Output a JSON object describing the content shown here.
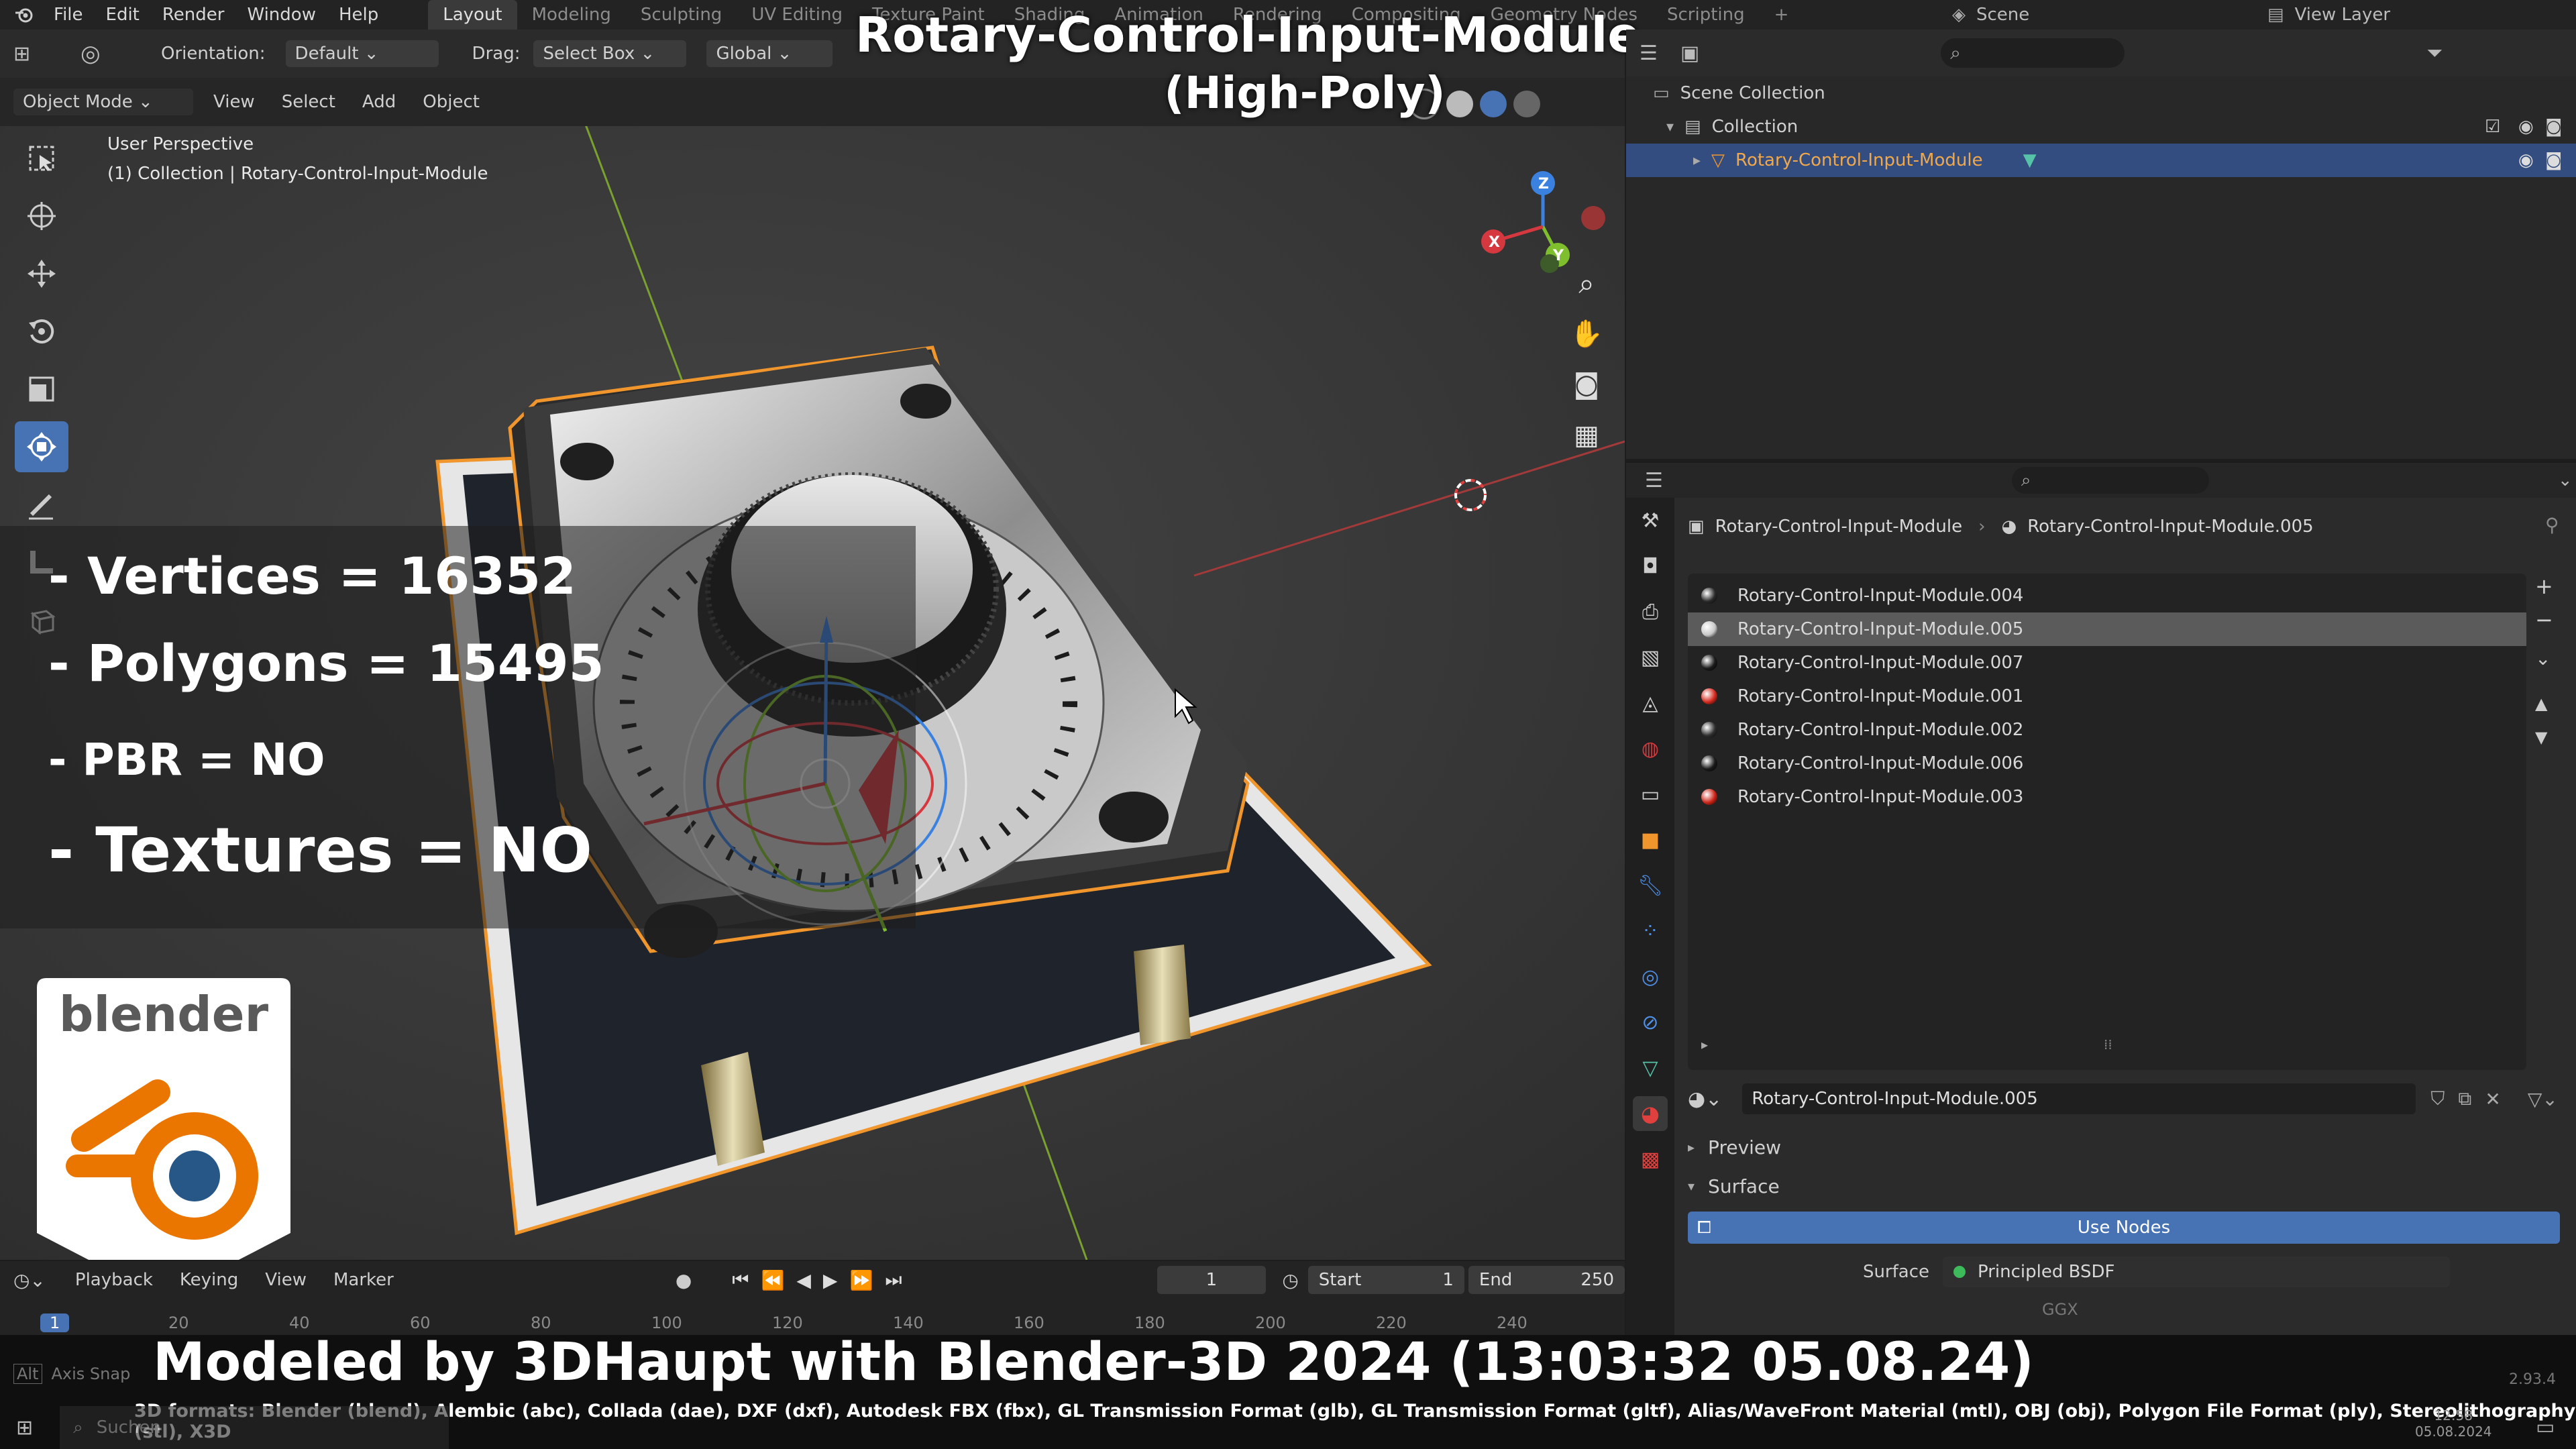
{
  "topbar": {
    "menus": [
      "File",
      "Edit",
      "Render",
      "Window",
      "Help"
    ],
    "workspaces": [
      "Layout",
      "Modeling",
      "Sculpting",
      "UV Editing",
      "Texture Paint",
      "Shading",
      "Animation",
      "Rendering",
      "Compositing",
      "Geometry Nodes",
      "Scripting"
    ],
    "active_workspace": "Layout",
    "add_tab": "+",
    "scene": "Scene",
    "view_layer": "View Layer"
  },
  "viewport_header": {
    "orientation_label": "Orientation:",
    "orientation_value": "Default",
    "drag_label": "Drag:",
    "drag_value": "Select Box",
    "transform": "Global",
    "mode": "Object Mode",
    "menus": [
      "View",
      "Select",
      "Add",
      "Object"
    ]
  },
  "viewport": {
    "perspective": "User Perspective",
    "collection_path": "(1) Collection | Rotary-Control-Input-Module",
    "gizmo_axes": {
      "x": "X",
      "y": "Y",
      "z": "Z"
    }
  },
  "overlay": {
    "title_line1": "Rotary-Control-Input-Module",
    "title_line2": "(High-Poly)",
    "vertices": "- Vertices = 16352",
    "polygons": "- Polygons = 15495",
    "pbr": "- PBR =  NO",
    "textures": "- Textures = NO",
    "logo_text": "blender",
    "caption": "Modeled by 3DHaupt with Blender-3D 2024 (13:03:32  05.08.24)",
    "formats": "3D formats: Blender (blend), Alembic (abc), Collada (dae), DXF (dxf), Autodesk FBX (fbx), GL Transmission Format (glb), GL Transmission Format (gltf), Alias/WaveFront Material (mtl), OBJ (obj), Polygon File Format (ply), Stereolithography (stl), X3D"
  },
  "outliner": {
    "scene_collection": "Scene Collection",
    "collection": "Collection",
    "object": "Rotary-Control-Input-Module"
  },
  "properties": {
    "object_name": "Rotary-Control-Input-Module",
    "material_name": "Rotary-Control-Input-Module.005",
    "materials": [
      {
        "name": "Rotary-Control-Input-Module.004",
        "color": "#2a2a2a"
      },
      {
        "name": "Rotary-Control-Input-Module.005",
        "color": "#c8c8c8"
      },
      {
        "name": "Rotary-Control-Input-Module.007",
        "color": "#1a1a1a"
      },
      {
        "name": "Rotary-Control-Input-Module.001",
        "color": "#d42a1e"
      },
      {
        "name": "Rotary-Control-Input-Module.002",
        "color": "#2f2f2f"
      },
      {
        "name": "Rotary-Control-Input-Module.006",
        "color": "#1a1a1a"
      },
      {
        "name": "Rotary-Control-Input-Module.003",
        "color": "#cc2418"
      }
    ],
    "selected_material_index": 1,
    "slot_material": "Rotary-Control-Input-Module.005",
    "preview_label": "Preview",
    "surface_section": "Surface",
    "use_nodes": "Use Nodes",
    "surface_label": "Surface",
    "surface_value": "Principled BSDF",
    "ggx": "GGX"
  },
  "timeline": {
    "playback": "Playback",
    "keying": "Keying",
    "view": "View",
    "marker": "Marker",
    "current_frame": "1",
    "start_label": "Start",
    "start_value": "1",
    "end_label": "End",
    "end_value": "250",
    "ticks": [
      "1",
      "20",
      "40",
      "60",
      "80",
      "100",
      "120",
      "140",
      "160",
      "180",
      "200",
      "220",
      "240"
    ]
  },
  "statusbar": {
    "axis_snap": "Axis Snap",
    "search": "Suchen",
    "version": "2.93.4",
    "time": "12:58",
    "date": "05.08.2024"
  },
  "colors": {
    "accent": "#4772b3",
    "selection_orange": "#f0962c",
    "x_axis": "#d5383e",
    "y_axis": "#7fbf2d",
    "z_axis": "#3b82e0"
  }
}
